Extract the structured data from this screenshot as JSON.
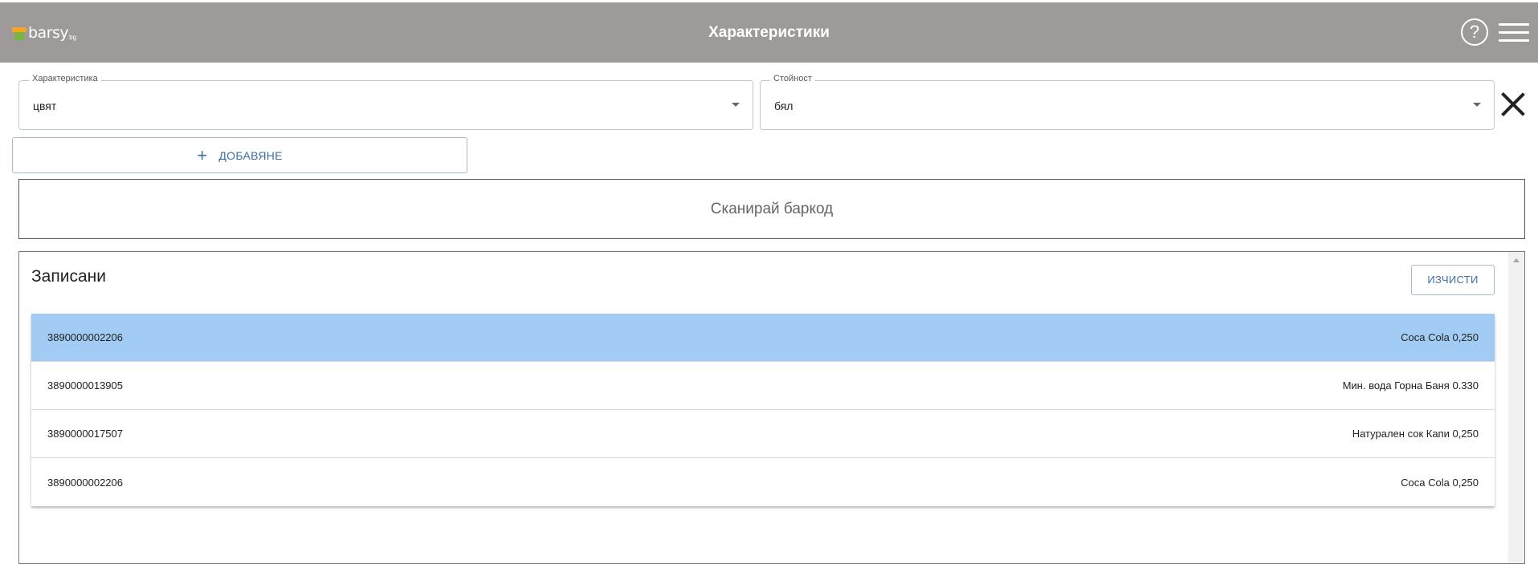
{
  "header": {
    "logo_text": "barsy",
    "logo_sub": "bg",
    "title": "Характеристики",
    "help_icon": "?"
  },
  "form": {
    "characteristic": {
      "label": "Характеристика",
      "value": "цвят"
    },
    "value": {
      "label": "Стойност",
      "value": "бял"
    },
    "add_label": "ДОБАВЯНЕ",
    "add_icon": "+"
  },
  "scan": {
    "label": "Сканирай баркод"
  },
  "recorded": {
    "title": "Записани",
    "clear_label": "ИЗЧИСТИ",
    "rows": [
      {
        "barcode": "3890000002206",
        "name": "Coca Cola 0,250",
        "selected": true
      },
      {
        "barcode": "3890000013905",
        "name": "Мин. вода Горна Баня 0.330",
        "selected": false
      },
      {
        "barcode": "3890000017507",
        "name": "Натурален сок Капи 0,250",
        "selected": false
      },
      {
        "barcode": "3890000002206",
        "name": "Coca Cola 0,250",
        "selected": false
      }
    ]
  }
}
